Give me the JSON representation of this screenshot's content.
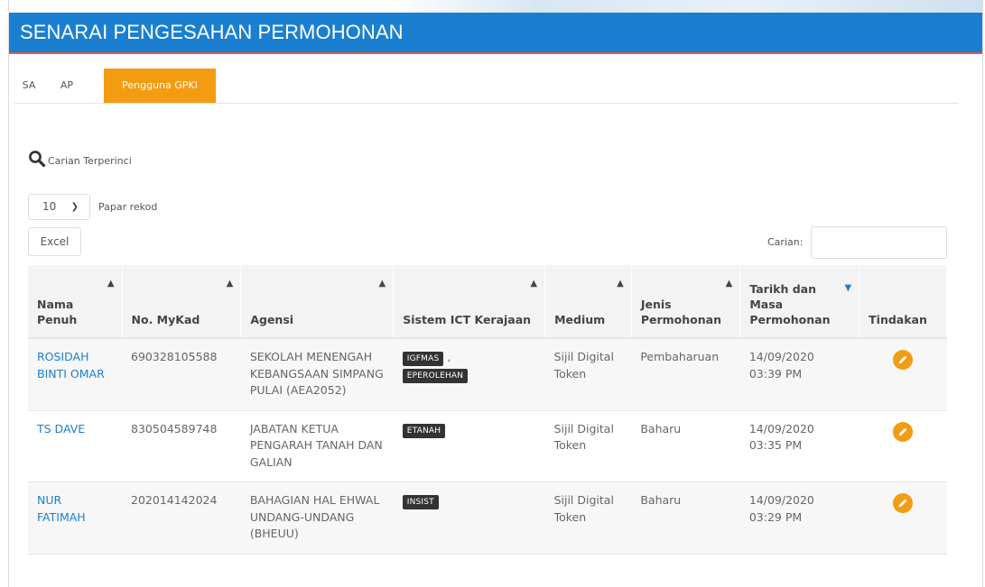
{
  "header": {
    "title": "SENARAI PENGESAHAN PERMOHONAN"
  },
  "tabs": [
    {
      "label": "SA",
      "active": false
    },
    {
      "label": "AP",
      "active": false
    },
    {
      "label": "Pengguna GPKI",
      "active": true
    }
  ],
  "advanced_search": {
    "label": "Carian Terperinci",
    "icon": "search-icon"
  },
  "page_length": {
    "value": "10",
    "label": "Papar rekod"
  },
  "excel_label": "Excel",
  "search": {
    "label": "Carian:",
    "value": ""
  },
  "columns": [
    "Nama Penuh",
    "No. MyKad",
    "Agensi",
    "Sistem ICT Kerajaan",
    "Medium",
    "Jenis Permohonan",
    "Tarikh dan Masa Permohonan",
    "Tindakan"
  ],
  "sorted_column": "Tarikh dan Masa Permohonan",
  "rows": [
    {
      "name": "ROSIDAH BINTI OMAR",
      "mykad": "690328105588",
      "agency": "SEKOLAH MENENGAH KEBANGSAAN SIMPANG PULAI (AEA2052)",
      "systems": [
        "IGFMAS",
        "EPEROLEHAN"
      ],
      "separator": ",",
      "medium": "Sijil Digital Token",
      "type": "Pembaharuan",
      "date": "14/09/2020",
      "time": "03:39 PM"
    },
    {
      "name": "TS DAVE",
      "mykad": "830504589748",
      "agency": "JABATAN KETUA PENGARAH TANAH DAN GALIAN",
      "systems": [
        "ETANAH"
      ],
      "medium": "Sijil Digital Token",
      "type": "Baharu",
      "date": "14/09/2020",
      "time": "03:35 PM"
    },
    {
      "name": "NUR FATIMAH",
      "mykad": "202014142024",
      "agency": "BAHAGIAN HAL EHWAL UNDANG-UNDANG (BHEUU)",
      "systems": [
        "INSIST"
      ],
      "medium": "Sijil Digital Token",
      "type": "Baharu",
      "date": "14/09/2020",
      "time": "03:29 PM"
    }
  ],
  "colors": {
    "header": "#1a7fd0",
    "accent": "#f39c12",
    "name_link": "#1a7fd0",
    "header_underline": "#e5574a"
  }
}
